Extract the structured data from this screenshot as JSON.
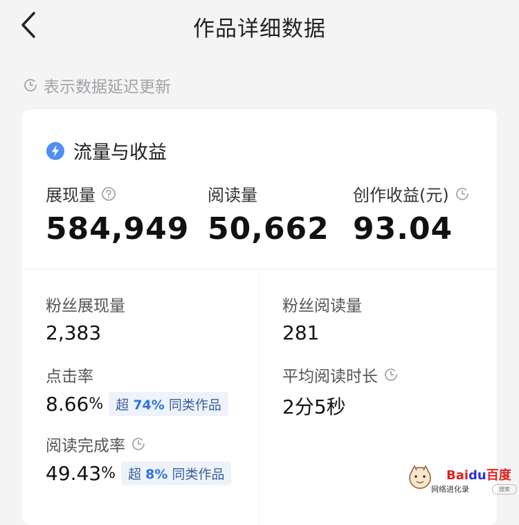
{
  "header": {
    "title": "作品详细数据"
  },
  "notice": {
    "text": "表示数据延迟更新"
  },
  "card": {
    "section_title": "流量与收益",
    "metrics": {
      "impressions": {
        "label": "展现量",
        "value": "584,949"
      },
      "reads": {
        "label": "阅读量",
        "value": "50,662"
      },
      "earnings": {
        "label": "创作收益(元)",
        "value": "93.04"
      }
    },
    "details": {
      "fan_impressions": {
        "label": "粉丝展现量",
        "value": "2,383"
      },
      "fan_reads": {
        "label": "粉丝阅读量",
        "value": "281"
      },
      "ctr": {
        "label": "点击率",
        "value": "8.66",
        "unit": "%",
        "tag_prefix": "超",
        "tag_pct": "74%",
        "tag_suffix": "同类作品"
      },
      "avg_read_time": {
        "label": "平均阅读时长",
        "value": "2分5秒"
      },
      "completion": {
        "label": "阅读完成率",
        "value": "49.43",
        "unit": "%",
        "tag_prefix": "超",
        "tag_pct": "8%",
        "tag_suffix": "同类作品"
      }
    }
  },
  "watermark": {
    "logo_part1": "Bai",
    "logo_part2": "du",
    "logo_part3": "百度",
    "caption": "网络进化录",
    "search": "搜索"
  },
  "colors": {
    "accent": "#2f72e0",
    "tag_bg": "#eef3fb",
    "background": "#f4f4f5"
  },
  "icons": {
    "back": "chevron-left-icon",
    "delay": "clock-icon",
    "section": "lightning-badge-icon",
    "help": "question-circle-icon"
  }
}
